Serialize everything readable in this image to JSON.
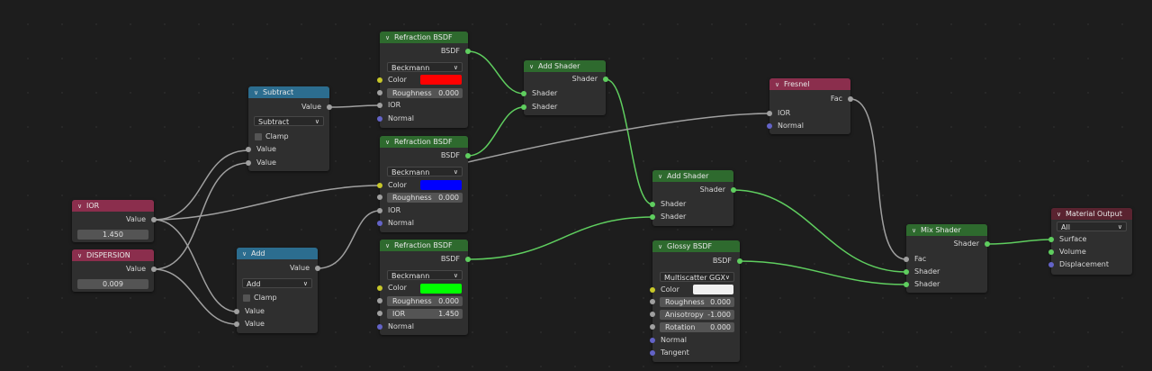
{
  "colors": {
    "canvas_bg": "#1d1d1d",
    "header_shader": "#2e6a2e",
    "header_input": "#8b2e4d",
    "header_converter": "#2c6d8f",
    "header_output": "#5a2330",
    "link_shader": "#5fce5f",
    "link_value": "#a0a0a0",
    "socket_color": "#c7c729",
    "socket_vector": "#6363c7"
  },
  "nodes": {
    "ior": {
      "title": "IOR",
      "out": "Value",
      "value": "1.450"
    },
    "dispersion": {
      "title": "DISPERSION",
      "out": "Value",
      "value": "0.009"
    },
    "subtract": {
      "title": "Subtract",
      "out": "Value",
      "op": "Subtract",
      "clamp": "Clamp",
      "in1": "Value",
      "in2": "Value"
    },
    "add": {
      "title": "Add",
      "out": "Value",
      "op": "Add",
      "clamp": "Clamp",
      "in1": "Value",
      "in2": "Value"
    },
    "refr1": {
      "title": "Refraction BSDF",
      "out": "BSDF",
      "dist": "Beckmann",
      "color": "Color",
      "color_hex": "#ff0000",
      "rough_lbl": "Roughness",
      "rough_val": "0.000",
      "ior": "IOR",
      "normal": "Normal"
    },
    "refr2": {
      "title": "Refraction BSDF",
      "out": "BSDF",
      "dist": "Beckmann",
      "color": "Color",
      "color_hex": "#0000ff",
      "rough_lbl": "Roughness",
      "rough_val": "0.000",
      "ior": "IOR",
      "normal": "Normal"
    },
    "refr3": {
      "title": "Refraction BSDF",
      "out": "BSDF",
      "dist": "Beckmann",
      "color": "Color",
      "color_hex": "#00ff00",
      "rough_lbl": "Roughness",
      "rough_val": "0.000",
      "ior_lbl": "IOR",
      "ior_val": "1.450",
      "normal": "Normal"
    },
    "add_shader1": {
      "title": "Add Shader",
      "out": "Shader",
      "in1": "Shader",
      "in2": "Shader"
    },
    "add_shader2": {
      "title": "Add Shader",
      "out": "Shader",
      "in1": "Shader",
      "in2": "Shader"
    },
    "fresnel": {
      "title": "Fresnel",
      "out": "Fac",
      "ior": "IOR",
      "normal": "Normal"
    },
    "glossy": {
      "title": "Glossy BSDF",
      "out": "BSDF",
      "dist": "Multiscatter GGX",
      "color": "Color",
      "color_hex": "#f0f0f0",
      "rough_lbl": "Roughness",
      "rough_val": "0.000",
      "aniso_lbl": "Anisotropy",
      "aniso_val": "-1.000",
      "rot_lbl": "Rotation",
      "rot_val": "0.000",
      "normal": "Normal",
      "tangent": "Tangent"
    },
    "mix": {
      "title": "Mix Shader",
      "out": "Shader",
      "fac": "Fac",
      "in1": "Shader",
      "in2": "Shader"
    },
    "output": {
      "title": "Material Output",
      "target": "All",
      "surface": "Surface",
      "volume": "Volume",
      "displacement": "Displacement"
    }
  }
}
